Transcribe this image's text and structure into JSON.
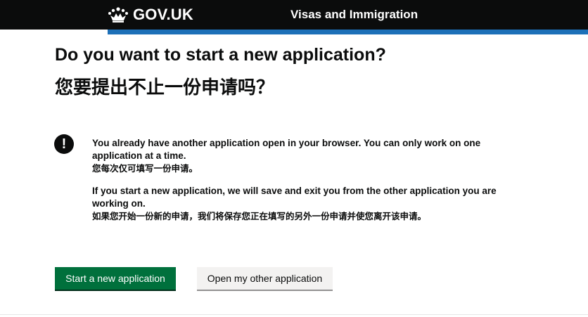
{
  "header": {
    "logo_text": "GOV.UK",
    "service_name": "Visas and Immigration",
    "background_color": "#0b0c0c",
    "accent_color": "#1d70b8"
  },
  "page": {
    "title_en": "Do you want to start a new application?",
    "title_zh": "您要提出不止一份申请吗？"
  },
  "warning": {
    "icon": "!",
    "para1_en": "You already have another application open in your browser. You can only work on one application at a time.",
    "para1_zh": "您每次仅可填写一份申请。",
    "para2_en": "If you start a new application, we will save and exit you from the other application you are working on.",
    "para2_zh": "如果您开始一份新的申请，我们将保存您正在填写的另外一份申请并使您离开该申请。"
  },
  "buttons": {
    "start_label": "Start a new application",
    "open_other_label": "Open my other application",
    "primary_color": "#00703c",
    "secondary_color": "#f3f2f1"
  }
}
